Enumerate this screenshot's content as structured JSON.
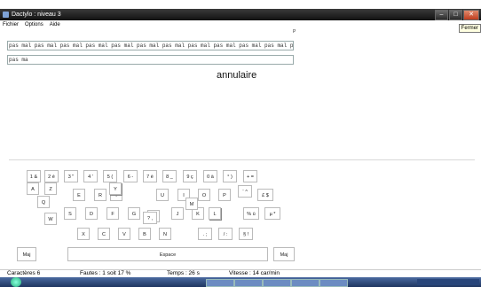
{
  "window": {
    "title": "Dactylo : niveau 3",
    "tooltip": "Fermer"
  },
  "menu": [
    "Fichier",
    "Options",
    "Aide"
  ],
  "p_mark": "P",
  "exercise": {
    "model_text": "pas mal pas mal pas mal pas mal pas mal pas mal pas mal pas mal pas mal pas mal pas mal pas mal",
    "typed_text": "pas ma",
    "word": "annulaire"
  },
  "keyboard": {
    "row1": [
      "1 &",
      "2 é",
      "3 \"",
      "4 '",
      "5 (",
      "6 -",
      "7 è",
      "8 _",
      "9 ç",
      "0 à",
      "° )",
      "+ ="
    ],
    "row2": [
      "A",
      "Z",
      "E",
      "R",
      "T",
      "Y",
      "U",
      "I",
      "O",
      "P",
      "¨ ^",
      "£ $"
    ],
    "row3": [
      "Q",
      "S",
      "D",
      "F",
      "G",
      "H",
      "J",
      "K",
      "L",
      "M",
      "% ù",
      "µ *"
    ],
    "row4": [
      "W",
      "X",
      "C",
      "V",
      "B",
      "N",
      "? ,",
      ". ;",
      "/ :",
      "§ !"
    ],
    "maj": "Maj",
    "space": "Espace"
  },
  "status": {
    "characters": "Caractères  6",
    "errors": "Fautes :  1 soit 17 %",
    "time": "Temps :  26 s",
    "speed": "Vitesse :  14 car/min"
  }
}
